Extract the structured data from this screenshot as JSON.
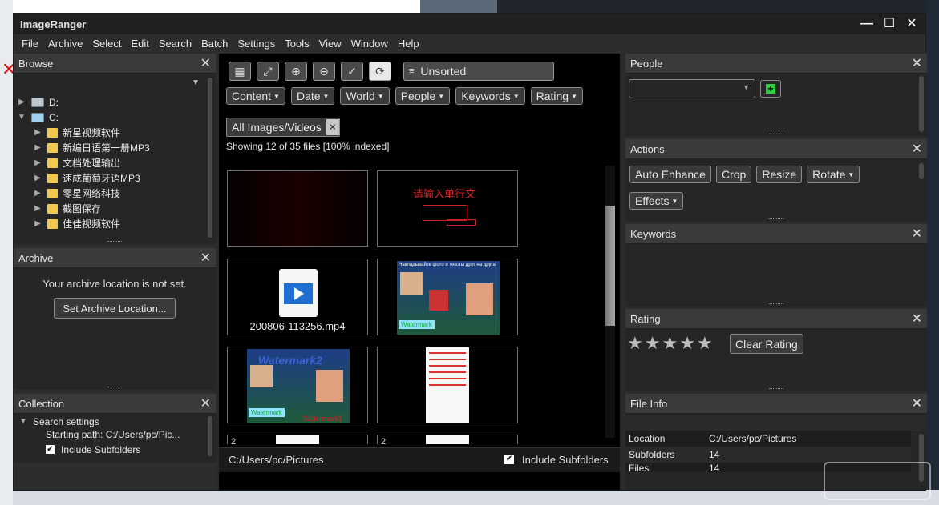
{
  "window": {
    "title": "ImageRanger"
  },
  "menu": [
    "File",
    "Archive",
    "Select",
    "Edit",
    "Search",
    "Batch",
    "Settings",
    "Tools",
    "View",
    "Window",
    "Help"
  ],
  "left": {
    "browse": {
      "title": "Browse",
      "drives": [
        {
          "label": "D:",
          "expanded": false
        },
        {
          "label": "C:",
          "expanded": true
        }
      ],
      "folders": [
        "新星视频软件",
        "新编日语第一册MP3",
        "文档处理输出",
        "速成葡萄牙语MP3",
        "零星网络科技",
        "截图保存",
        "佳佳视频软件"
      ]
    },
    "archive": {
      "title": "Archive",
      "message": "Your archive location is not set.",
      "button": "Set Archive Location..."
    },
    "collection": {
      "title": "Collection",
      "search_settings": "Search settings",
      "starting_path": "Starting path: C:/Users/pc/Pic...",
      "include_subfolders": "Include Subfolders"
    }
  },
  "center": {
    "sort": "Unsorted",
    "filters": [
      "Content",
      "Date",
      "World",
      "People",
      "Keywords",
      "Rating"
    ],
    "tag": "All Images/Videos",
    "showing": "Showing 12 of 35 files [100% indexed]",
    "thumb_text": "请输入单行文",
    "video_name": "200806-113256.mp4",
    "russian_caption": "Накладывайте фото и тексты друг на друга!",
    "watermark_label": "Watermark",
    "watermark2_label": "Watermark2",
    "watermark1_label": "Watermark1",
    "footer_path": "C:/Users/pc/Pictures",
    "footer_include": "Include Subfolders",
    "partial_label": "2"
  },
  "right": {
    "people": {
      "title": "People",
      "add": "+"
    },
    "actions": {
      "title": "Actions",
      "buttons": [
        "Auto Enhance",
        "Crop",
        "Resize",
        "Rotate",
        "Effects"
      ]
    },
    "keywords": {
      "title": "Keywords"
    },
    "rating": {
      "title": "Rating",
      "stars": 5,
      "clear": "Clear Rating"
    },
    "fileinfo": {
      "title": "File Info",
      "rows": [
        {
          "k": "Location",
          "v": "C:/Users/pc/Pictures"
        },
        {
          "k": "Subfolders",
          "v": "14"
        },
        {
          "k": "Files",
          "v": "14"
        }
      ]
    }
  },
  "colors": {
    "accent_green": "#2ecc40",
    "folder": "#f2c94c"
  }
}
